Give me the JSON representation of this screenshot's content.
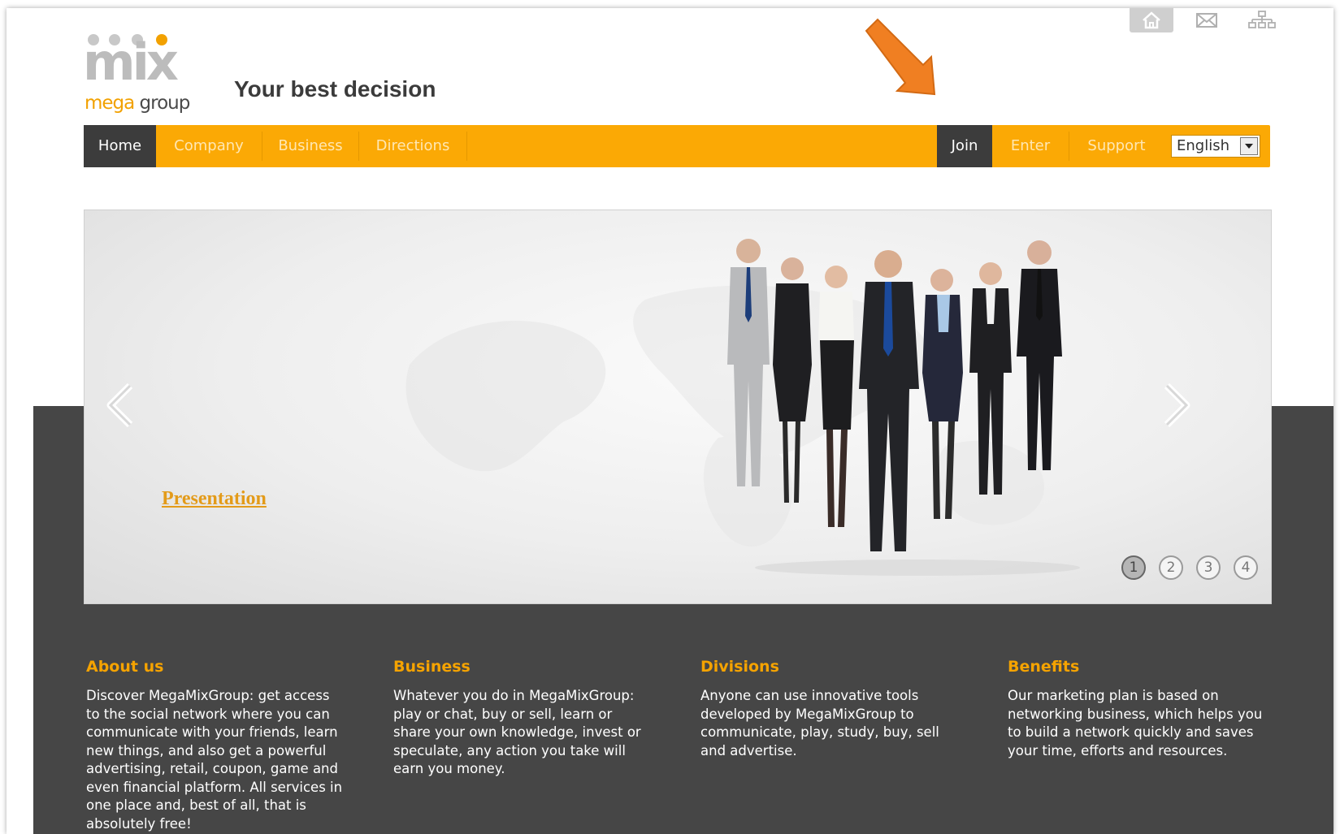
{
  "header": {
    "logo": {
      "word": "mix",
      "sub_prefix": "mega",
      "sub_suffix": " group"
    },
    "tagline": "Your best decision",
    "top_icons": [
      "home-icon",
      "mail-icon",
      "sitemap-icon"
    ]
  },
  "nav": {
    "left": [
      {
        "label": "Home",
        "active": true
      },
      {
        "label": "Company",
        "active": false
      },
      {
        "label": "Business",
        "active": false
      },
      {
        "label": "Directions",
        "active": false
      }
    ],
    "right": [
      {
        "label": "Join",
        "active": true
      },
      {
        "label": "Enter",
        "active": false
      },
      {
        "label": "Support",
        "active": false
      }
    ],
    "language": "English"
  },
  "slider": {
    "link": "Presentation",
    "pages": [
      "1",
      "2",
      "3",
      "4"
    ],
    "active_page": "1"
  },
  "columns": [
    {
      "title": "About us",
      "text": "Discover MegaMixGroup: get access to the social network where you can communicate with your friends, learn new things, and also get a powerful advertising, retail, coupon, game and even financial platform. All services in one place and, best of all, that is absolutely free!"
    },
    {
      "title": "Business",
      "text": "Whatever you do in MegaMixGroup: play or chat, buy or sell, learn or share your own knowledge, invest or speculate, any action you take will earn you money."
    },
    {
      "title": "Divisions",
      "text": "Anyone can use innovative tools developed by MegaMixGroup to communicate, play, study, buy, sell and advertise."
    },
    {
      "title": "Benefits",
      "text": "Our marketing plan is based on networking business, which helps you to build a network quickly and saves your time, efforts and resources."
    }
  ],
  "colors": {
    "brand_orange": "#fba905",
    "dark": "#464646",
    "active_tab": "#3c3c3c",
    "annotation_arrow": "#f07f22"
  }
}
